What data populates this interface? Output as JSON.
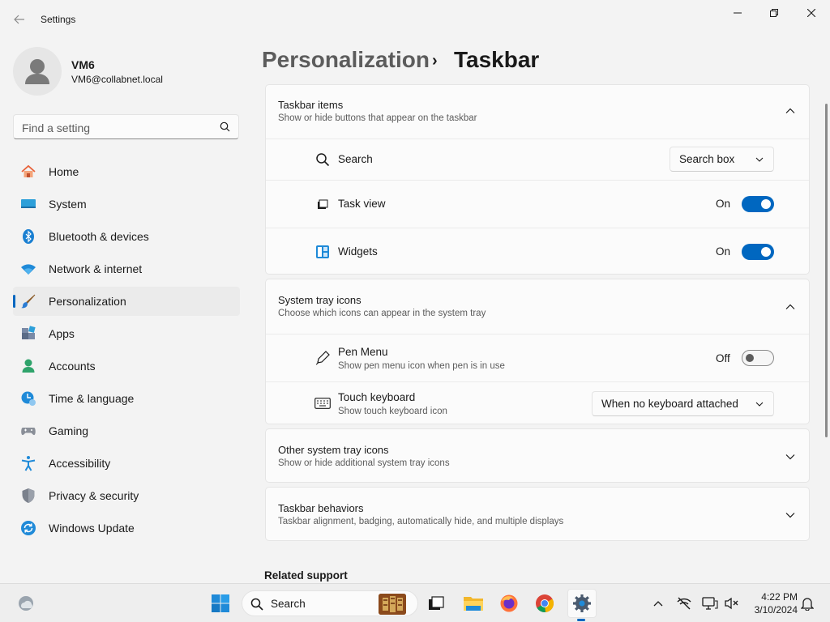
{
  "window": {
    "app_title": "Settings"
  },
  "user": {
    "name": "VM6",
    "email": "VM6@collabnet.local"
  },
  "search": {
    "placeholder": "Find a setting"
  },
  "nav": {
    "items": [
      {
        "label": "Home",
        "icon": "home-icon"
      },
      {
        "label": "System",
        "icon": "system-icon"
      },
      {
        "label": "Bluetooth & devices",
        "icon": "bluetooth-icon"
      },
      {
        "label": "Network & internet",
        "icon": "wifi-icon"
      },
      {
        "label": "Personalization",
        "icon": "paintbrush-icon",
        "active": true
      },
      {
        "label": "Apps",
        "icon": "apps-icon"
      },
      {
        "label": "Accounts",
        "icon": "accounts-icon"
      },
      {
        "label": "Time & language",
        "icon": "time-language-icon"
      },
      {
        "label": "Gaming",
        "icon": "gamepad-icon"
      },
      {
        "label": "Accessibility",
        "icon": "accessibility-icon"
      },
      {
        "label": "Privacy & security",
        "icon": "shield-icon"
      },
      {
        "label": "Windows Update",
        "icon": "windows-update-icon"
      }
    ]
  },
  "breadcrumb": {
    "parent": "Personalization",
    "separator": "›",
    "current": "Taskbar"
  },
  "taskbar_items": {
    "title": "Taskbar items",
    "subtitle": "Show or hide buttons that appear on the taskbar",
    "search": {
      "label": "Search",
      "value": "Search box"
    },
    "task_view": {
      "label": "Task view",
      "state": "On"
    },
    "widgets": {
      "label": "Widgets",
      "state": "On"
    }
  },
  "system_tray": {
    "title": "System tray icons",
    "subtitle": "Choose which icons can appear in the system tray",
    "pen_menu": {
      "label": "Pen Menu",
      "sub": "Show pen menu icon when pen is in use",
      "state": "Off"
    },
    "touch_keyboard": {
      "label": "Touch keyboard",
      "sub": "Show touch keyboard icon",
      "value": "When no keyboard attached"
    }
  },
  "other_tray": {
    "title": "Other system tray icons",
    "subtitle": "Show or hide additional system tray icons"
  },
  "behaviors": {
    "title": "Taskbar behaviors",
    "subtitle": "Taskbar alignment, badging, automatically hide, and multiple displays"
  },
  "related": {
    "title": "Related support"
  },
  "taskbar": {
    "search_label": "Search",
    "time": "4:22 PM",
    "date": "3/10/2024",
    "apps": [
      "start-icon",
      "task-view-icon",
      "file-explorer-icon",
      "firefox-icon",
      "chrome-icon",
      "settings-icon"
    ]
  },
  "colors": {
    "accent": "#0067c0",
    "background": "#f3f3f3",
    "card": "#fbfbfb"
  }
}
